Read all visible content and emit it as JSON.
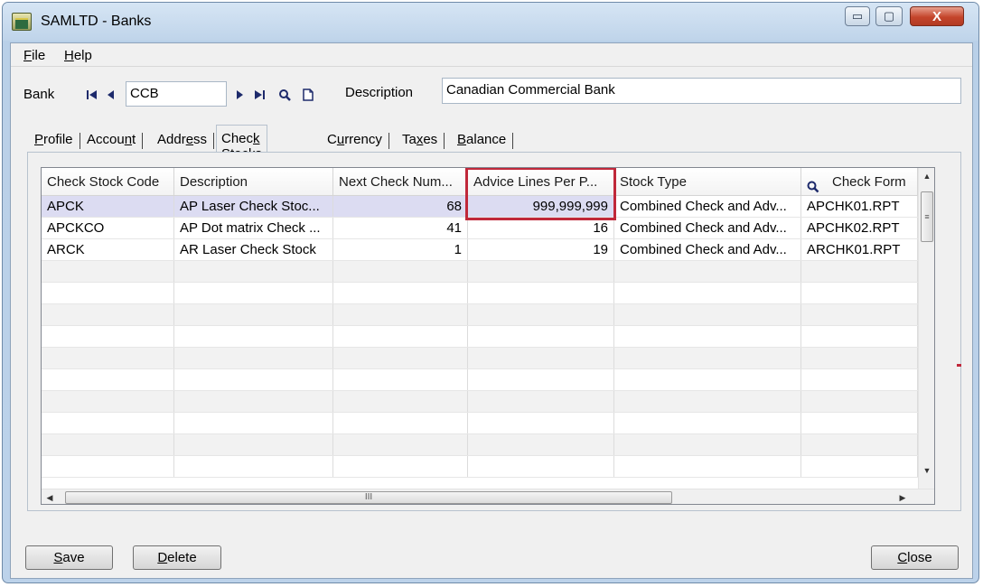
{
  "window": {
    "title": "SAMLTD - Banks",
    "controls": {
      "minimize": "▭",
      "maximize": "▢",
      "close": "X"
    }
  },
  "menu": {
    "file": {
      "accel": "F",
      "rest": "ile"
    },
    "help": {
      "accel": "H",
      "rest": "elp"
    }
  },
  "bank": {
    "label": "Bank",
    "code": "CCB",
    "description_label": "Description",
    "description": "Canadian Commercial Bank"
  },
  "tabs": [
    {
      "pre": "",
      "accel": "P",
      "post": "rofile"
    },
    {
      "pre": "Accou",
      "accel": "n",
      "post": "t"
    },
    {
      "pre": "Addr",
      "accel": "e",
      "post": "ss"
    },
    {
      "pre": "Chec",
      "accel": "k",
      "post": " Stocks"
    },
    {
      "pre": "C",
      "accel": "u",
      "post": "rrency"
    },
    {
      "pre": "Ta",
      "accel": "x",
      "post": "es"
    },
    {
      "pre": "",
      "accel": "B",
      "post": "alance"
    }
  ],
  "grid": {
    "columns": [
      "Check Stock Code",
      "Description",
      "Next Check Num...",
      "Advice Lines Per P...",
      "Stock Type",
      "Check Form"
    ],
    "rows": [
      [
        "APCK",
        "AP Laser Check Stoc...",
        "68",
        "999,999,999",
        "Combined Check and Adv...",
        "APCHK01.RPT"
      ],
      [
        "APCKCO",
        "AP Dot matrix Check ...",
        "41",
        "16",
        "Combined Check and Adv...",
        "APCHK02.RPT"
      ],
      [
        "ARCK",
        "AR Laser Check Stock",
        "1",
        "19",
        "Combined Check and Adv...",
        "ARCHK01.RPT"
      ]
    ],
    "selected_row": 0,
    "highlighted_column": "Advice Lines Per P...",
    "scroll_glyph": "III"
  },
  "buttons": {
    "save": {
      "accel": "S",
      "rest": "ave"
    },
    "delete": {
      "accel": "D",
      "rest": "elete"
    },
    "close": {
      "accel": "C",
      "rest": "lose"
    }
  },
  "colors": {
    "selected_row": "#dcdcf2",
    "highlight_border": "#c0283a",
    "window_frame": "#bfd4ea"
  }
}
